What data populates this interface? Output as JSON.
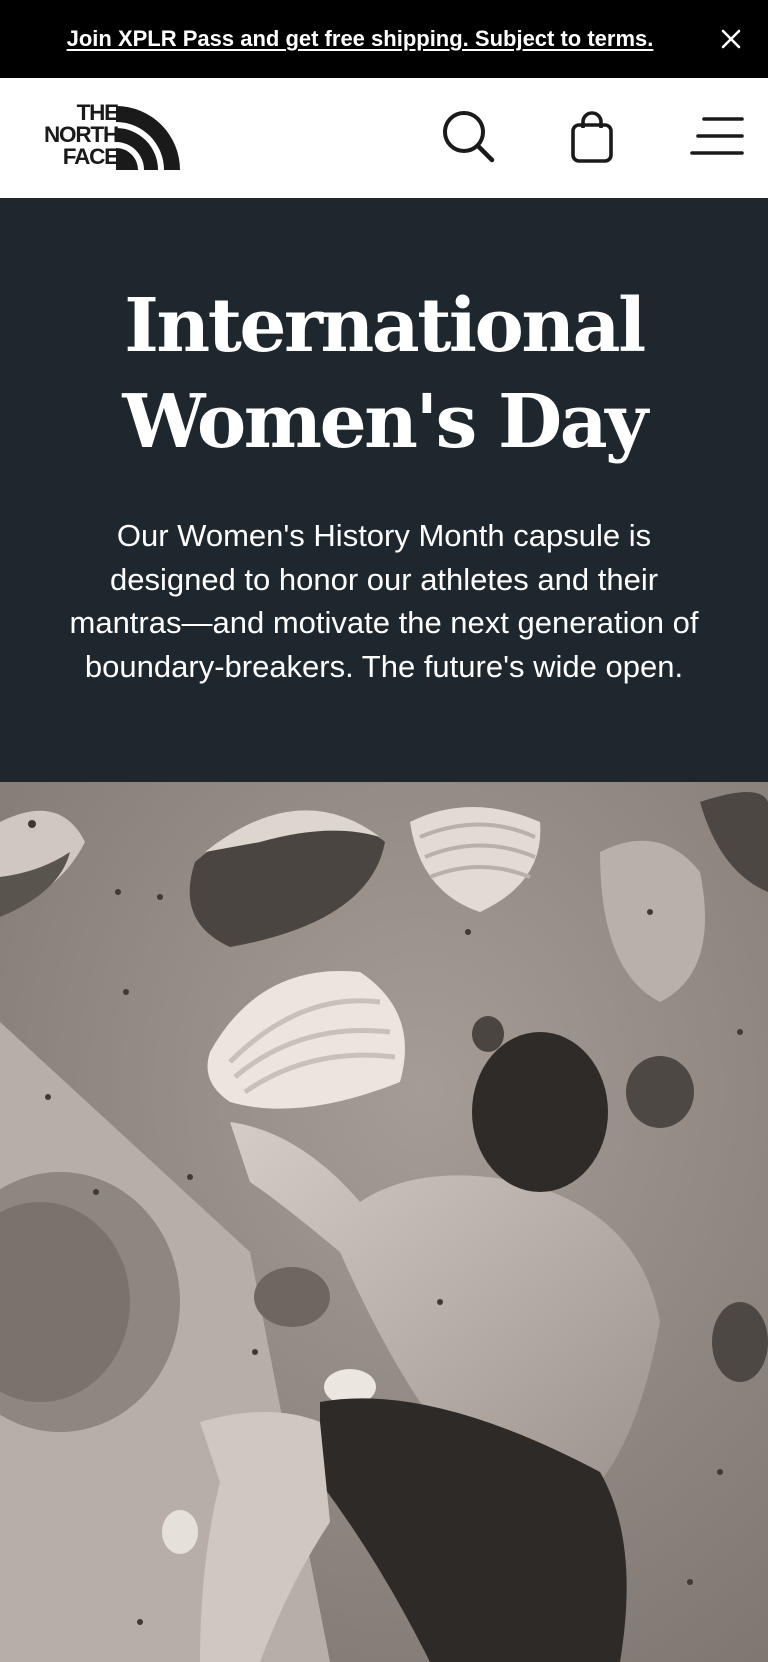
{
  "promo": {
    "text": "Join XPLR Pass and get free shipping. Subject to terms."
  },
  "header": {
    "logo_lines": [
      "THE",
      "NORTH",
      "FACE"
    ]
  },
  "hero": {
    "title": "International Women's Day",
    "body": "Our Women's History Month capsule is designed to honor our athletes and their mantras—and motivate the next generation of boundary-breakers. The future's wide open."
  },
  "icons": {
    "close": "close-icon",
    "search": "search-icon",
    "bag": "shopping-bag-icon",
    "menu": "hamburger-menu-icon",
    "logo": "the-north-face-logo"
  },
  "colors": {
    "banner_bg": "#000000",
    "hero_bg": "#1f272e",
    "text_light": "#ffffff",
    "text_dark": "#1a1a1a"
  }
}
